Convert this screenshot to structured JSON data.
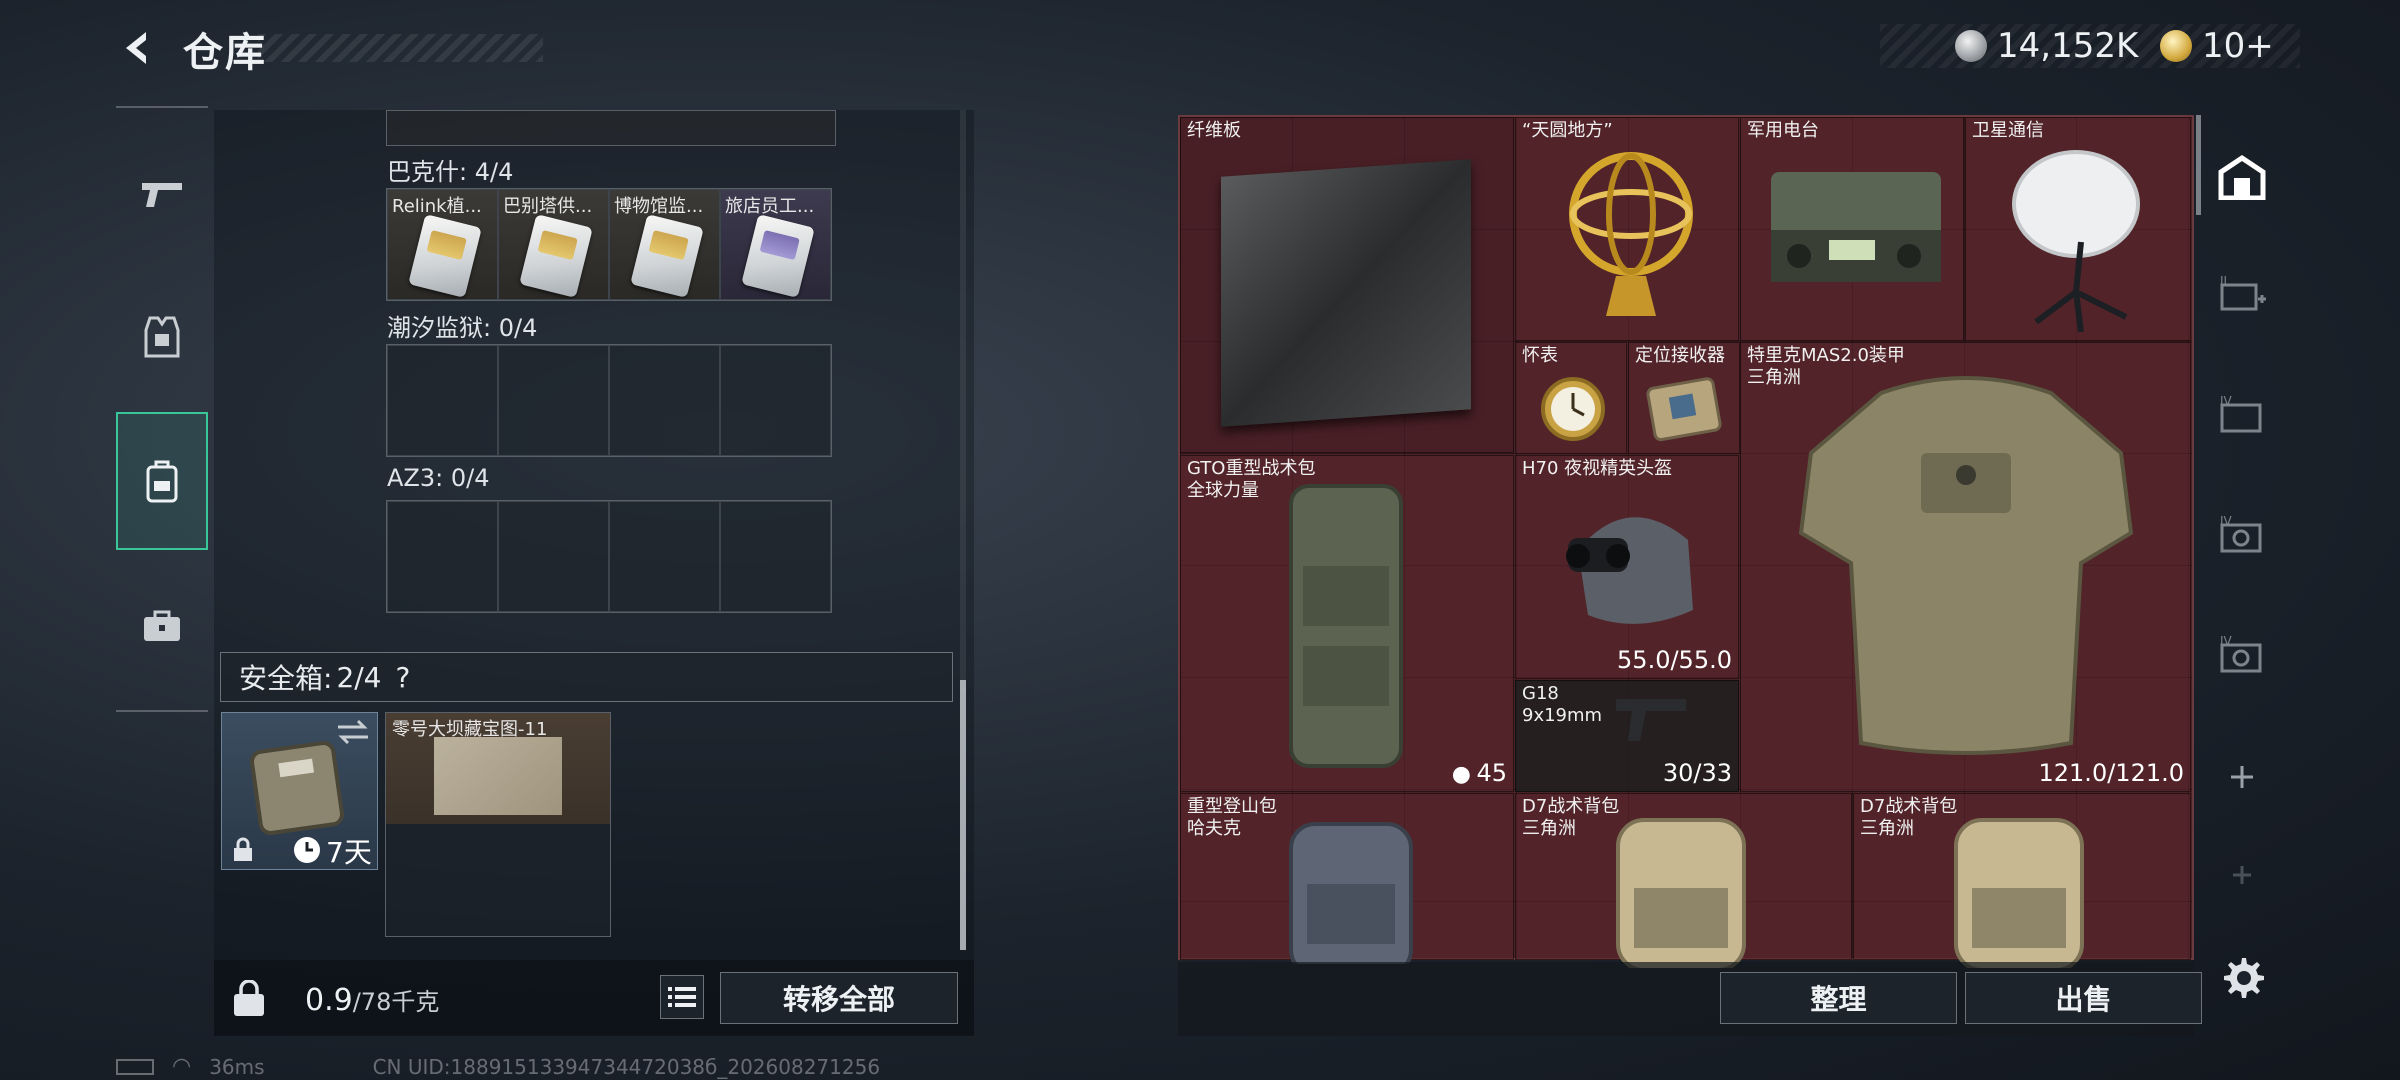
{
  "header": {
    "title": "仓库",
    "currency": [
      {
        "icon": "silver-coin-icon",
        "value": "14,152K"
      },
      {
        "icon": "gold-coin-icon",
        "value": "10+"
      }
    ]
  },
  "left_nav": [
    "pistol-icon",
    "armor-rig-icon",
    "backpack-icon",
    "case-icon"
  ],
  "left_panel": {
    "sections": [
      {
        "label": "巴克什: 4/4",
        "cards": [
          "Relink植...",
          "巴别塔供...",
          "博物馆监...",
          "旅店员工..."
        ]
      },
      {
        "label": "潮汐监狱: 0/4",
        "cards": []
      },
      {
        "label": "AZ3: 0/4",
        "cards": []
      }
    ],
    "safebox": {
      "label": "安全箱:",
      "count": "2/4",
      "help": "?",
      "duration": "7天"
    },
    "map_item": "零号大坝藏宝图-11",
    "weight": "0.9",
    "weight_max": "/78千克",
    "transfer_label": "转移全部"
  },
  "status_bar": {
    "ping": "36ms",
    "uid": "CN UID:18891513394734472038б_202608271256"
  },
  "storage_items": [
    {
      "name": "纤维板"
    },
    {
      "name": "“天圆地方”"
    },
    {
      "name": "军用电台"
    },
    {
      "name": "卫星通信"
    },
    {
      "name": "怀表"
    },
    {
      "name": "定位接收器"
    },
    {
      "name": "特里克MAS2.0装甲",
      "sub": "三角洲",
      "value": "121.0/121.0"
    },
    {
      "name": "GTO重型战术包",
      "sub": "全球力量",
      "value": "45"
    },
    {
      "name": "H70 夜视精英头盔",
      "value": "55.0/55.0"
    },
    {
      "name": "G18",
      "sub": "9x19mm",
      "value": "30/33"
    },
    {
      "name": "重型登山包",
      "sub": "哈夫克"
    },
    {
      "name": "D7战术背包",
      "sub": "三角洲"
    },
    {
      "name": "D7战术背包",
      "sub": "三角洲"
    }
  ],
  "storage_actions": {
    "sort": "整理",
    "sell": "出售"
  },
  "right_nav": [
    "storage-home-icon",
    "tab-ii-icon",
    "tab-iv-a-icon",
    "tab-iv-b-icon",
    "tab-iv-c-icon",
    "add-icon",
    "add-icon-faded",
    "settings-icon"
  ],
  "colors": {
    "accent": "#39c79a",
    "storage_bg": "#4b2226"
  }
}
